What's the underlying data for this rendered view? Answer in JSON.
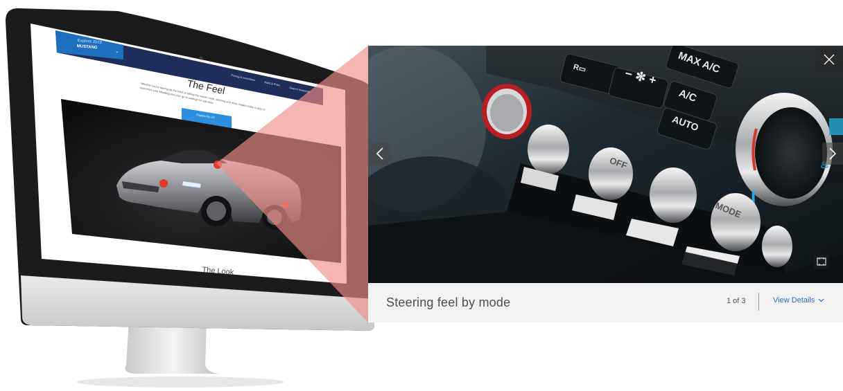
{
  "monitor_screen": {
    "header_small": "Explore 2019",
    "header_model": "MUSTANG",
    "nav_items": [
      "Pricing & Incentives",
      "Build & Price",
      "Search Inventory"
    ],
    "section_title": "The Feel",
    "section_body": "Whether you're tearing up the track or taking the scenic route, steering and drive modes make it easy to customize your Mustang and your go-to settings for ride-time.",
    "cta_label": "Explore the GT",
    "bottom_heading": "The Look"
  },
  "lightbox": {
    "caption": "Steering feel by mode",
    "counter": "1 of 3",
    "view_details": "View Details",
    "photo_labels": {
      "max_ac": "MAX A/C",
      "ac": "A/C",
      "auto": "AUTO",
      "off": "OFF",
      "mode": "MODE"
    }
  },
  "colors": {
    "accent_blue": "#2a6ebb",
    "callout_red": "#e23b2e",
    "callout_overlay": "#f08a80"
  },
  "icons": [
    "chevron-left-icon",
    "chevron-right-icon",
    "close-icon",
    "expand-icon",
    "chevron-down-icon",
    "fan-icon",
    "rear-defrost-icon",
    "seat-heat-icon"
  ]
}
